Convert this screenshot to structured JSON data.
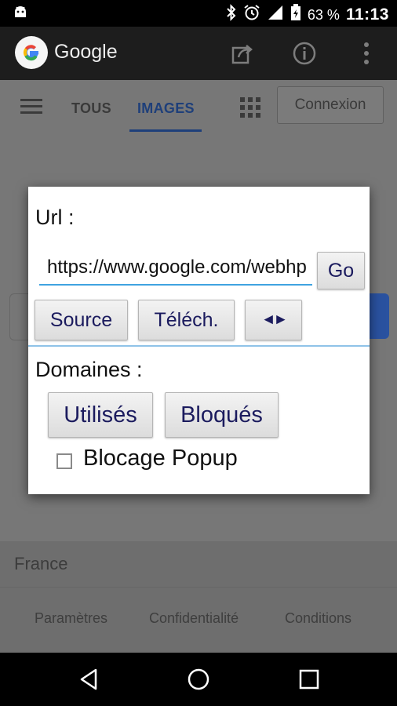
{
  "status_bar": {
    "battery_percent": "63 %",
    "time": "11:13",
    "icons": [
      "android-icon",
      "bluetooth-icon",
      "alarm-icon",
      "signal-icon",
      "battery-icon"
    ]
  },
  "app_bar": {
    "title": "Google",
    "actions": [
      "share-icon",
      "info-icon",
      "overflow-menu-icon"
    ]
  },
  "page": {
    "tabs": [
      {
        "label": "TOUS",
        "active": false
      },
      {
        "label": "IMAGES",
        "active": true
      }
    ],
    "connexion_label": "Connexion",
    "country": "France",
    "footer_links": [
      "Paramètres",
      "Confidentialité",
      "Conditions"
    ],
    "accent_color": "#1e3f7a"
  },
  "dialog": {
    "url_label": "Url :",
    "url_value": "https://www.google.com/webhp",
    "go_label": "Go",
    "source_label": "Source",
    "telech_label": "Téléch.",
    "arrows_label": "◄►",
    "domaines_label": "Domaines :",
    "utilises_label": "Utilisés",
    "bloques_label": "Bloqués",
    "popup_label": "Blocage Popup",
    "popup_checked": false,
    "button_text_color": "#1b1b5e",
    "divider_color": "#8fc3e8"
  },
  "nav_bar": {
    "buttons": [
      "back-icon",
      "home-icon",
      "recents-icon"
    ]
  }
}
